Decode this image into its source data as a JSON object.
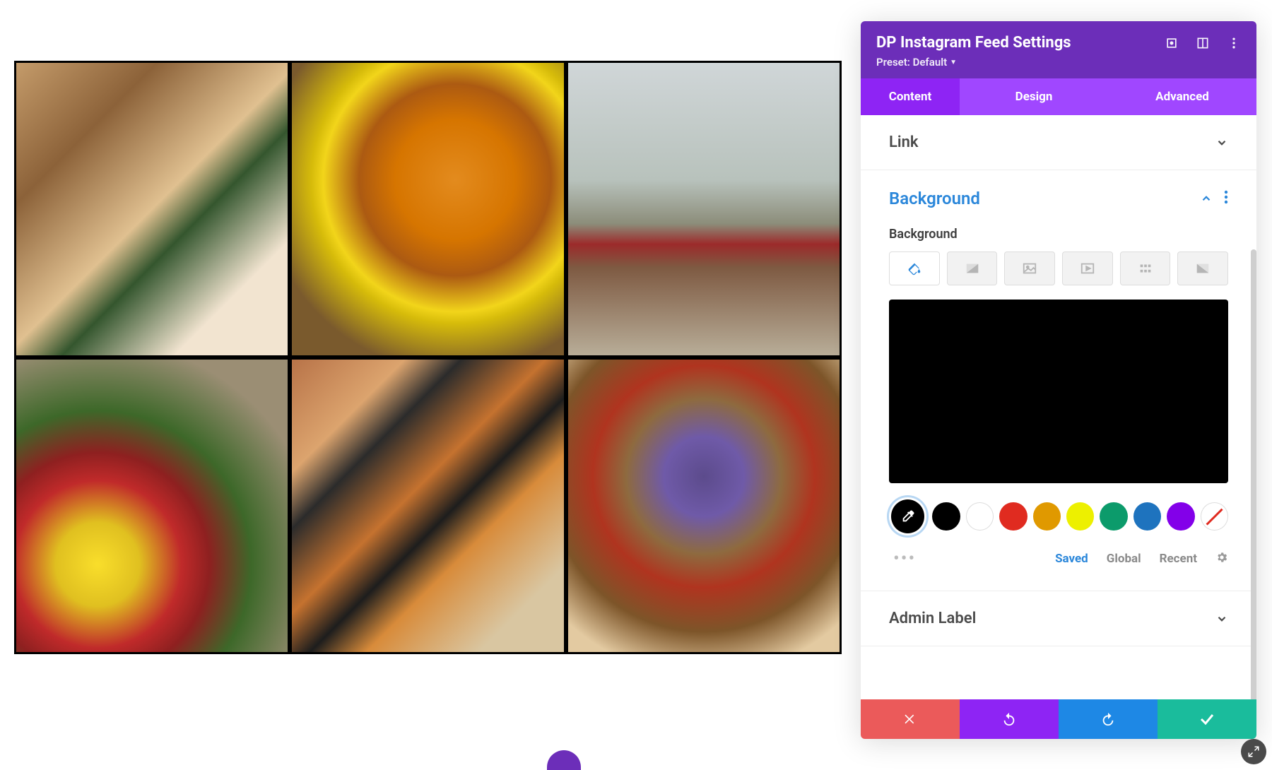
{
  "panel": {
    "title": "DP Instagram Feed Settings",
    "preset_label": "Preset: Default",
    "tabs": {
      "content": "Content",
      "design": "Design",
      "advanced": "Advanced",
      "active": "content"
    },
    "sections": {
      "link": {
        "title": "Link",
        "expanded": false
      },
      "background": {
        "title": "Background",
        "expanded": true,
        "label": "Background",
        "type_tabs": [
          "color",
          "gradient",
          "image",
          "video",
          "pattern",
          "mask"
        ],
        "type_active": "color",
        "preview_color": "#000000",
        "palette_links": {
          "saved": "Saved",
          "global": "Global",
          "recent": "Recent"
        },
        "swatches": [
          "#000000",
          "#ffffff",
          "#e02b20",
          "#e09900",
          "#edf000",
          "#0c9b6b",
          "#1e73be",
          "#8300e9",
          "transparent"
        ]
      },
      "admin_label": {
        "title": "Admin Label",
        "expanded": false
      }
    },
    "footer": {
      "cancel": "cancel",
      "undo": "undo",
      "redo": "redo",
      "save": "save"
    }
  }
}
